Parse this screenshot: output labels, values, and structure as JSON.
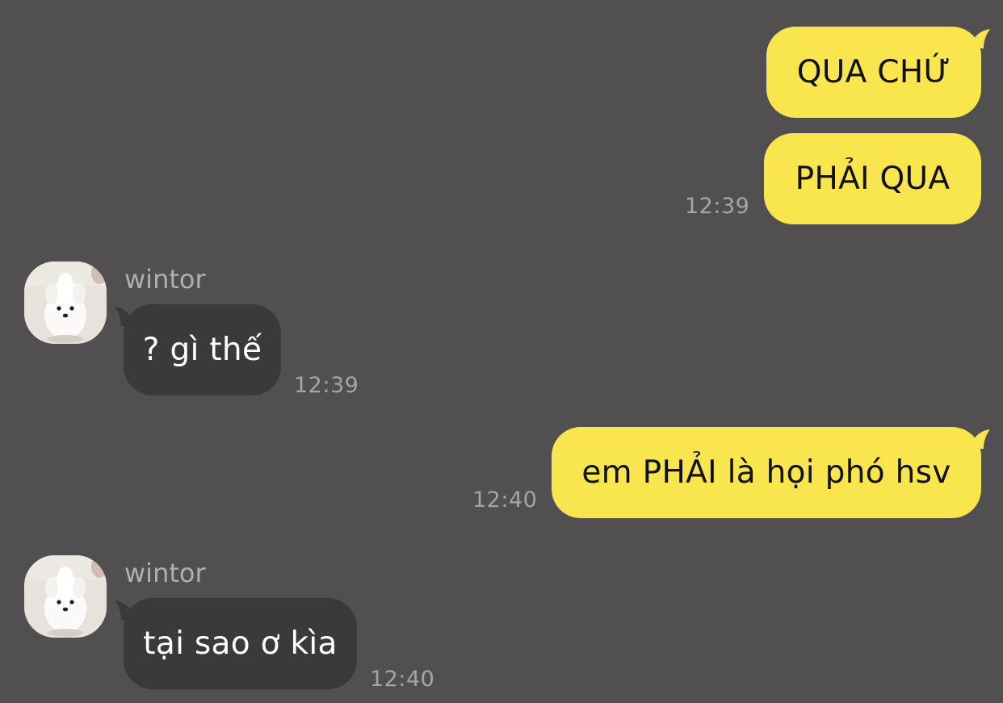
{
  "messages": [
    {
      "id": "m1",
      "side": "out",
      "text": "QUA CHỨ"
    },
    {
      "id": "m2",
      "side": "out",
      "text": "PHẢI QUA",
      "time": "12:39"
    },
    {
      "id": "m3",
      "side": "in",
      "sender": "wintor",
      "text": "? gì thế",
      "time": "12:39"
    },
    {
      "id": "m4",
      "side": "out",
      "text": "em PHẢI là họi phó hsv",
      "time": "12:40"
    },
    {
      "id": "m5",
      "side": "in",
      "sender": "wintor",
      "text": "tại sao ơ kìa",
      "time": "12:40"
    }
  ],
  "colors": {
    "background": "#514f50",
    "outgoing_bubble": "#f9e54d",
    "incoming_bubble": "#3a393b",
    "timestamp": "#a6a4a5"
  },
  "icons": {
    "avatar": "white-dog-avatar-icon"
  }
}
